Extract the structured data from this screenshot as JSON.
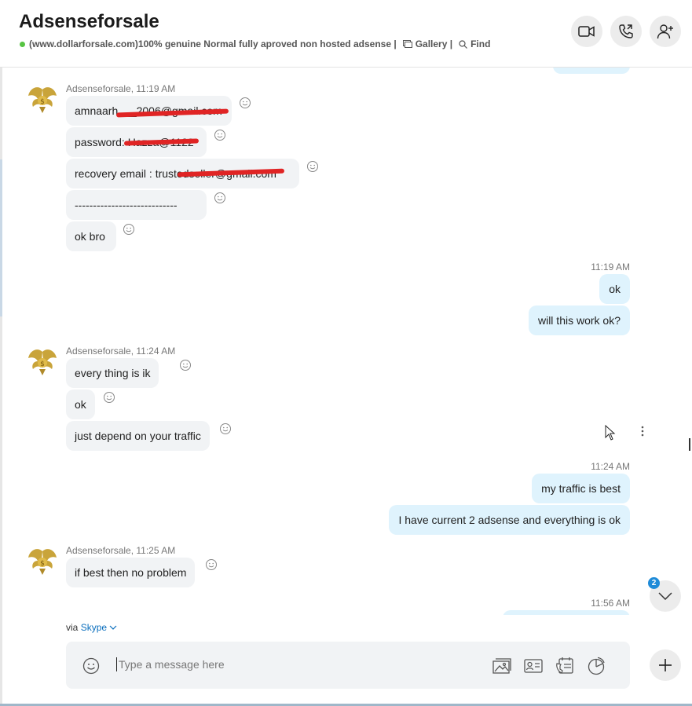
{
  "header": {
    "title": "Adsenseforsale",
    "subtitle": "(www.dollarforsale.com)100% genuine Normal fully aproved non hosted adsense |",
    "gallery": "Gallery |",
    "find": "Find",
    "status_color": "#57c443"
  },
  "messages": {
    "group1": {
      "sender": "Adsenseforsale, 11:19 AM",
      "m1": "amnaarh___2006@gmail.com",
      "m2": "password:  Hazza@1122",
      "m3": "recovery email :  trustedseller@gmail.com",
      "m4": "----------------------------",
      "m5": "ok bro"
    },
    "out1": {
      "time": "11:19 AM",
      "m1": "ok",
      "m2": "will this work ok?"
    },
    "group2": {
      "sender": "Adsenseforsale, 11:24 AM",
      "m1": "every thing is ik",
      "m2": "ok",
      "m3": "just depend on your traffic"
    },
    "out2": {
      "time": "11:24 AM",
      "m1": "my traffic is best",
      "m2": "I have current 2 adsense and everything is ok"
    },
    "group3": {
      "sender": "Adsenseforsale, 11:25 AM",
      "m1": "if best then no problem"
    },
    "out3": {
      "time": "11:56 AM"
    }
  },
  "footer": {
    "via": "via",
    "via_link": "Skype",
    "placeholder": "Type a message here",
    "unread_count": "2"
  },
  "colors": {
    "incoming_bubble": "#f1f3f5",
    "outgoing_bubble": "#dff3fd",
    "accent": "#0a6ebd",
    "redaction": "#e02424"
  }
}
